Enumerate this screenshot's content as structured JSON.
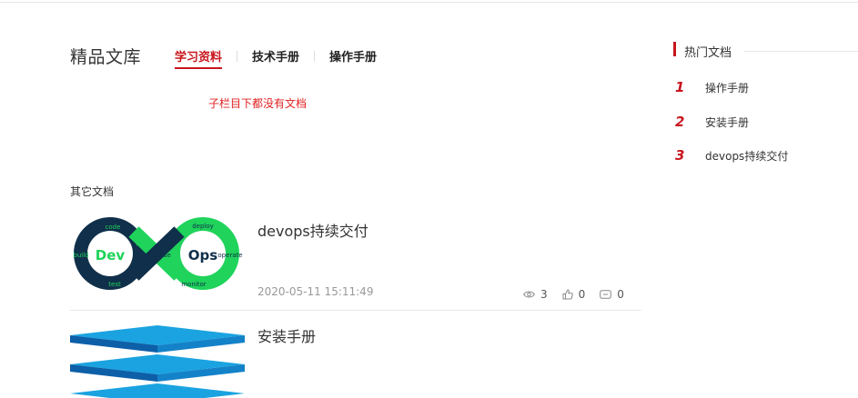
{
  "library": {
    "title": "精品文库"
  },
  "tabs": [
    {
      "label": "学习资料",
      "active": true
    },
    {
      "label": "技术手册",
      "active": false
    },
    {
      "label": "操作手册",
      "active": false
    }
  ],
  "empty_message": "子栏目下都没有文档",
  "other_docs": {
    "title": "其它文档",
    "items": [
      {
        "title": "devops持续交付",
        "date": "2020-05-11 15:11:49",
        "views": "3",
        "likes": "0",
        "comments": "0",
        "thumb_text": {
          "left": "Dev",
          "right": "Ops"
        },
        "thumb_labels": [
          "code",
          "plan",
          "build",
          "test",
          "release",
          "deploy",
          "operate",
          "monitor"
        ]
      },
      {
        "title": "安装手册"
      }
    ]
  },
  "hot_docs": {
    "title": "热门文档",
    "items": [
      {
        "rank": "1",
        "label": "操作手册"
      },
      {
        "rank": "2",
        "label": "安装手册"
      },
      {
        "rank": "3",
        "label": "devops持续交付"
      }
    ]
  },
  "colors": {
    "accent": "#c8161d",
    "devops_green": "#1fd35b",
    "devops_navy": "#102f4a",
    "blue": "#1aa3e0"
  },
  "icons": {
    "views": "eye-icon",
    "likes": "thumbs-up-icon",
    "comments": "comment-icon"
  }
}
